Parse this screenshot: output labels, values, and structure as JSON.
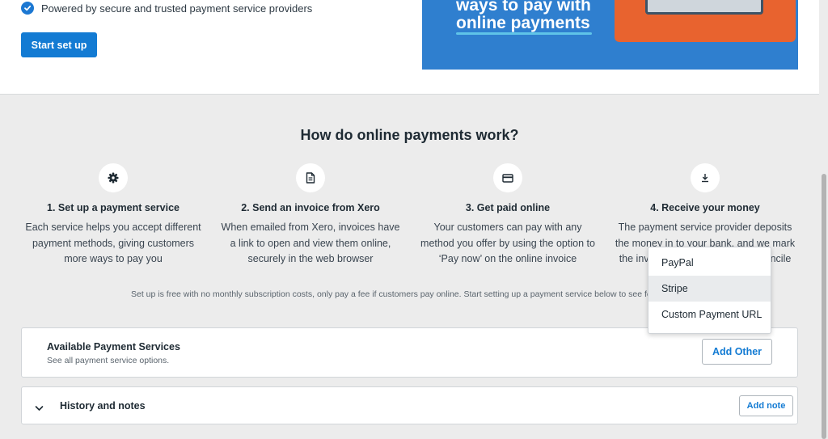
{
  "header": {
    "check_text": "Powered by secure and trusted payment service providers",
    "start_button": "Start set up",
    "promo_line1": "ways to pay with",
    "promo_line2": "online payments"
  },
  "how": {
    "title": "How do online payments work?",
    "steps": [
      {
        "icon": "gear-icon",
        "title": "1. Set up a payment service",
        "desc": [
          "Each service helps you accept different",
          "payment methods, giving customers",
          "more ways to pay you"
        ]
      },
      {
        "icon": "document-icon",
        "title": "2. Send an invoice from Xero",
        "desc": [
          "When emailed from Xero, invoices have",
          "a link to open and view them online,",
          "securely in the web browser"
        ]
      },
      {
        "icon": "card-icon",
        "title": "3. Get paid online",
        "desc": [
          "Your customers can pay with any",
          "method you offer by using the option to",
          "‘Pay now’ on the online invoice"
        ]
      },
      {
        "icon": "download-icon",
        "title": "4. Receive your money",
        "desc": [
          "The payment service provider deposits",
          "the money in to your bank, and we mark",
          "the invoice as paid for you to reconcile"
        ]
      }
    ],
    "note": "Set up is free with no monthly subscription costs, only pay a fee if customers pay online. Start setting up a payment service below to see fees."
  },
  "services": {
    "title": "Available Payment Services",
    "subtitle": "See all payment service options.",
    "add_other": "Add Other"
  },
  "history": {
    "title": "History and notes",
    "add_note": "Add note"
  },
  "dropdown": {
    "items": [
      "PayPal",
      "Stripe",
      "Custom Payment URL"
    ],
    "highlighted": "Stripe"
  },
  "colors": {
    "accent": "#137bd3",
    "promo_bg": "#2f7fcf",
    "promo_device": "#e8632f"
  }
}
